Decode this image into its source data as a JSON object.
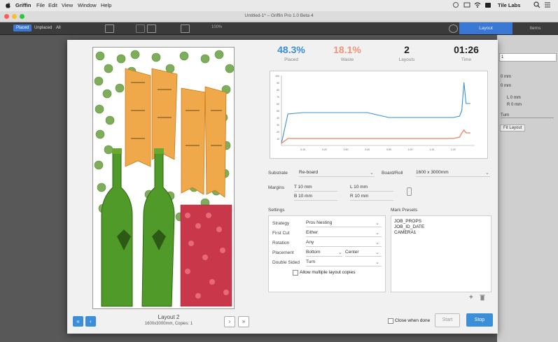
{
  "menubar": {
    "apple": "",
    "items": [
      "Griffin",
      "File",
      "Edit",
      "View",
      "Window",
      "Help"
    ],
    "right_app": "Tile Labs"
  },
  "window": {
    "title": "Untitled-1* – Griffin Pro 1.0 Beta 4"
  },
  "toolbar": {
    "seg_placed": "Placed",
    "seg_unplaced": "Unplaced",
    "seg_all": "All",
    "zoom": "100%",
    "tab_layout": "Layout",
    "tab_items": "Items"
  },
  "right_panel": {
    "field1": "1",
    "mm1": "0 mm",
    "mm2": "0 mm",
    "l": "L 0 mm",
    "r": "R 0 mm",
    "turn": "Turn",
    "fit_layout": "Fit Layout"
  },
  "stats": {
    "placed": {
      "value": "48.3%",
      "label": "Placed",
      "color": "#3a8fd8"
    },
    "waste": {
      "value": "18.1%",
      "label": "Waste",
      "color": "#f0957a"
    },
    "layouts": {
      "value": "2",
      "label": "Layouts",
      "color": "#222222"
    },
    "time": {
      "value": "01:26",
      "label": "Time",
      "color": "#222222"
    }
  },
  "chart_data": {
    "type": "line",
    "title": "",
    "xlabel": "",
    "ylabel": "",
    "ylim": [
      0,
      100
    ],
    "yticks": [
      10,
      20,
      30,
      40,
      50,
      60,
      70,
      80,
      90,
      100
    ],
    "xticks": [
      "0:10",
      "0:20",
      "0:30",
      "0:40",
      "0:50",
      "1:00",
      "1:10",
      "1:20"
    ],
    "x": [
      0,
      3,
      10,
      20,
      30,
      40,
      50,
      60,
      70,
      80,
      83,
      84,
      85,
      86,
      88
    ],
    "series": [
      {
        "name": "",
        "color": "#3a8fd8",
        "values": [
          3,
          45,
          47,
          47,
          47,
          47,
          40,
          40,
          40,
          40,
          42,
          50,
          90,
          60,
          60
        ]
      },
      {
        "name": "",
        "color": "#f0957a",
        "values": [
          3,
          10,
          10,
          10,
          10,
          10,
          10,
          10,
          10,
          10,
          12,
          18,
          22,
          18,
          18
        ]
      }
    ],
    "grid": false
  },
  "substrate": {
    "label": "Substrate",
    "value": "Re-board",
    "board_label": "Board/Roll",
    "board_value": "1600 x 3000mm"
  },
  "margins": {
    "label": "Margins",
    "t": "T  10 mm",
    "b": "B  10 mm",
    "l": "L  10 mm",
    "r": "R  10 mm"
  },
  "settings": {
    "title": "Settings",
    "rows": [
      {
        "label": "Strategy",
        "value": "Pros Nesting"
      },
      {
        "label": "First Cut",
        "value": "Either"
      },
      {
        "label": "Rotation",
        "value": "Any"
      },
      {
        "label": "Placement",
        "value": "Bottom",
        "value2": "Center"
      },
      {
        "label": "Double Sided",
        "value": "Turn"
      }
    ],
    "allow_multiple": "Allow multiple layout copies"
  },
  "mark_presets": {
    "title": "Mark Presets",
    "items": [
      "JOB_PROPS",
      "JOB_ID_DATE",
      "CAMERA1"
    ]
  },
  "footer": {
    "layout_name": "Layout 2",
    "layout_info": "1600x3000mm, Copies: 1",
    "close_when_done": "Close when done",
    "start": "Start",
    "stop": "Stop"
  }
}
